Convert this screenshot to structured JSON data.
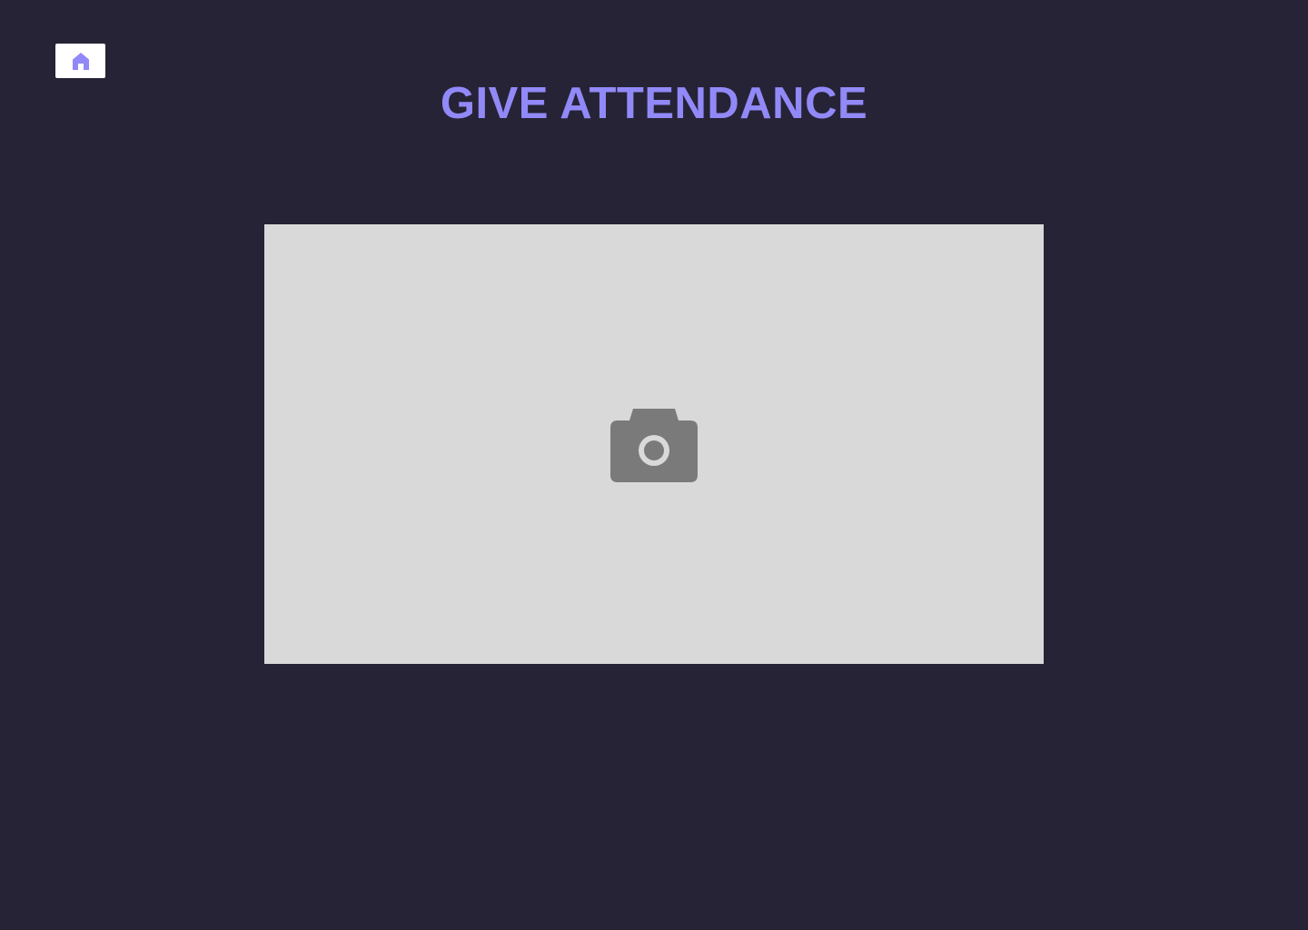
{
  "page": {
    "title": "GIVE ATTENDANCE",
    "background_color": "#262336",
    "accent_color": "#9289f8"
  },
  "home_button": {
    "icon": "home-icon",
    "icon_color": "#9289f8",
    "background_color": "#ffffff"
  },
  "camera_view": {
    "icon": "camera-icon",
    "icon_color": "#7a7a7a",
    "background_color": "#d9d9d9"
  }
}
